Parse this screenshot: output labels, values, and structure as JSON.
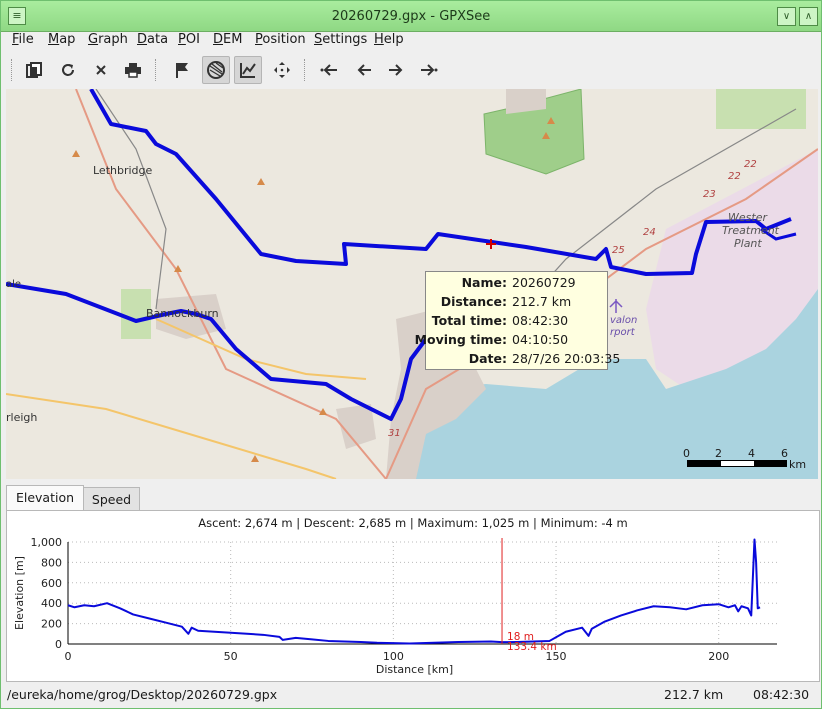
{
  "window": {
    "title": "20260729.gpx - GPXSee",
    "minimize_glyph": "∨",
    "maximize_glyph": "∧",
    "close_glyph": "×",
    "menu_glyph": "⌄"
  },
  "menu": [
    "File",
    "Map",
    "Graph",
    "Data",
    "POI",
    "DEM",
    "Position",
    "Settings",
    "Help"
  ],
  "toolbar": {
    "icons": [
      "open-icon",
      "reload-icon",
      "close-icon",
      "print-icon",
      "flag-icon",
      "show-map-icon",
      "show-graphs-icon",
      "fullscreen-icon",
      "first-file-icon",
      "previous-file-icon",
      "next-file-icon",
      "last-file-icon"
    ],
    "active": [
      "show-map-icon",
      "show-graphs-icon"
    ]
  },
  "map": {
    "labels": {
      "lethbridge": "Lethbridge",
      "bannockburn": "Bannockburn",
      "corleigh": "rleigh",
      "treatment": [
        "Wester",
        "Treatment",
        "Plant"
      ],
      "avalon": [
        "valon",
        "rport"
      ],
      "ale": "ale"
    },
    "road_numbers": [
      "22",
      "22",
      "23",
      "24",
      "25",
      "31"
    ],
    "colors": {
      "track": "#0a0adb",
      "land": "#ece8df",
      "water": "#aad3df",
      "park": "#c8e0b0",
      "urban": "#d9d0c9",
      "industrial": "#ebdbe8",
      "forest": "#9fce8a"
    }
  },
  "tooltip": {
    "rows": [
      {
        "key": "Name:",
        "value": "20260729"
      },
      {
        "key": "Distance:",
        "value": "212.7 km"
      },
      {
        "key": "Total time:",
        "value": "08:42:30"
      },
      {
        "key": "Moving time:",
        "value": "04:10:50"
      },
      {
        "key": "Date:",
        "value": "28/7/26 20:03:35"
      }
    ]
  },
  "scale": {
    "ticks": [
      "0",
      "2",
      "4",
      "6"
    ],
    "unit": "km"
  },
  "tabs": [
    {
      "label": "Elevation",
      "active": true
    },
    {
      "label": "Speed",
      "active": false
    }
  ],
  "graph": {
    "info": "Ascent: 2,674 m | Descent: 2,685 m | Maximum: 1,025 m | Minimum: -4 m",
    "cursor": {
      "value": "18 m",
      "distance": "133.4 km"
    }
  },
  "chart_data": {
    "type": "line",
    "xlabel": "Distance [km]",
    "ylabel": "Elevation [m]",
    "xlim": [
      0,
      213
    ],
    "ylim": [
      0,
      1000
    ],
    "xticks": [
      "0",
      "50",
      "100",
      "150",
      "200"
    ],
    "yticks": [
      "0",
      "200",
      "400",
      "600",
      "800",
      "1,000"
    ],
    "grid": true,
    "color": "#0a0adb",
    "cursor_x": 133.4,
    "x": [
      0,
      2,
      5,
      8,
      12,
      16,
      20,
      25,
      30,
      35,
      37,
      38,
      40,
      45,
      50,
      55,
      60,
      65,
      66,
      70,
      75,
      80,
      85,
      90,
      95,
      100,
      105,
      110,
      115,
      120,
      125,
      130,
      133.4,
      138,
      143,
      148,
      153,
      158,
      160,
      161,
      165,
      170,
      175,
      180,
      185,
      190,
      195,
      200,
      203,
      205,
      206,
      207,
      209,
      210,
      211,
      211.5,
      212,
      212.7
    ],
    "y": [
      380,
      360,
      380,
      370,
      400,
      350,
      290,
      250,
      210,
      170,
      100,
      160,
      130,
      120,
      110,
      100,
      90,
      70,
      40,
      60,
      45,
      30,
      25,
      20,
      12,
      8,
      5,
      10,
      15,
      20,
      22,
      25,
      18,
      20,
      25,
      30,
      120,
      160,
      80,
      150,
      220,
      280,
      330,
      370,
      360,
      340,
      380,
      390,
      360,
      380,
      320,
      370,
      350,
      280,
      1025,
      800,
      350,
      360
    ]
  },
  "status": {
    "path": "/eureka/home/grog/Desktop/20260729.gpx",
    "distance": "212.7 km",
    "time": "08:42:30"
  }
}
